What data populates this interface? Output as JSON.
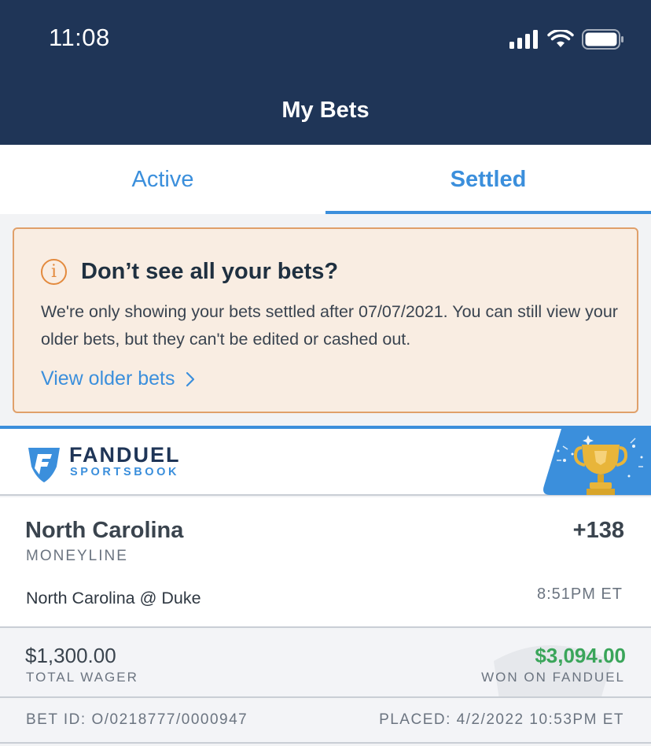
{
  "status_bar": {
    "time": "11:08"
  },
  "header": {
    "title": "My Bets"
  },
  "tabs": [
    {
      "label": "Active",
      "active": false
    },
    {
      "label": "Settled",
      "active": true
    }
  ],
  "notice": {
    "icon": "info-icon",
    "title": "Don’t see all your bets?",
    "body": "We're only showing your bets settled after 07/07/2021. You can still view your older bets, but they can't be edited or cashed out.",
    "link_label": "View older bets"
  },
  "bet": {
    "brand_name": "FANDUEL",
    "brand_sub": "SPORTSBOOK",
    "badge_icon": "trophy-icon",
    "selection": "North Carolina",
    "market": "MONEYLINE",
    "odds": "+138",
    "event": "North Carolina @ Duke",
    "event_time": "8:51PM ET",
    "wager": "$1,300.00",
    "wager_label": "TOTAL WAGER",
    "payout": "$3,094.00",
    "payout_label": "WON ON FANDUEL",
    "bet_id": "BET ID: O/0218777/0000947",
    "placed": "PLACED: 4/2/2022 10:53PM ET"
  },
  "colors": {
    "header_bg": "#1f3557",
    "accent_blue": "#3b8fdc",
    "notice_bg": "#f9ede2",
    "notice_border": "#e0a06a",
    "win_green": "#3aa55a",
    "trophy_gold": "#e8b53a"
  }
}
